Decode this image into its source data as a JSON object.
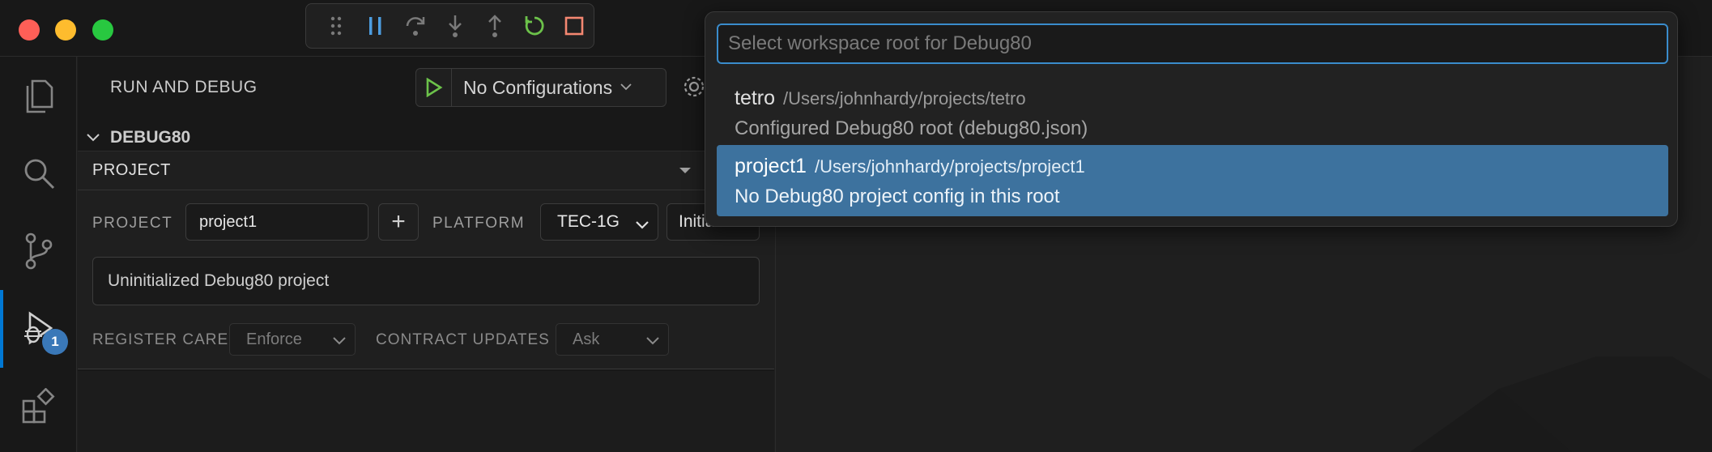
{
  "window": {
    "controls": [
      "close",
      "minimize",
      "maximize"
    ]
  },
  "debug_toolbar": {
    "buttons": [
      "drag-handle",
      "pause",
      "step-over",
      "step-into",
      "step-out",
      "restart",
      "stop"
    ],
    "colors": {
      "pause": "#4d9de0",
      "restart": "#6cc24a",
      "stop": "#f48771",
      "disabled": "#7a7a7a"
    }
  },
  "activity_bar": {
    "items": [
      "explorer-icon",
      "search-icon",
      "source-control-icon",
      "run-debug-icon",
      "extensions-icon"
    ],
    "active": "run-debug-icon",
    "debug_badge": "1"
  },
  "sidebar": {
    "header": "RUN AND DEBUG",
    "config_label": "No Configurations",
    "section_title": "DEBUG80",
    "panel_title": "PROJECT",
    "project_label": "PROJECT",
    "project_value": "project1",
    "add_label": "+",
    "platform_label": "PLATFORM",
    "platform_value": "TEC-1G",
    "init_value": "Initia",
    "status_text": "Uninitialized Debug80 project",
    "register_care_label": "REGISTER CARE",
    "register_care_value": "Enforce",
    "contract_updates_label": "CONTRACT UPDATES",
    "contract_updates_value": "Ask"
  },
  "quickpick": {
    "placeholder": "Select workspace root for Debug80",
    "value": "",
    "items": [
      {
        "name": "tetro",
        "path": "/Users/johnhardy/projects/tetro",
        "detail": "Configured Debug80 root (debug80.json)",
        "selected": false
      },
      {
        "name": "project1",
        "path": "/Users/johnhardy/projects/project1",
        "detail": "No Debug80 project config in this root",
        "selected": true
      }
    ]
  },
  "colors": {
    "accent": "#3a8ccc",
    "selection": "#3d729e",
    "badge": "#3a78b8",
    "run_green": "#6cc24a"
  }
}
